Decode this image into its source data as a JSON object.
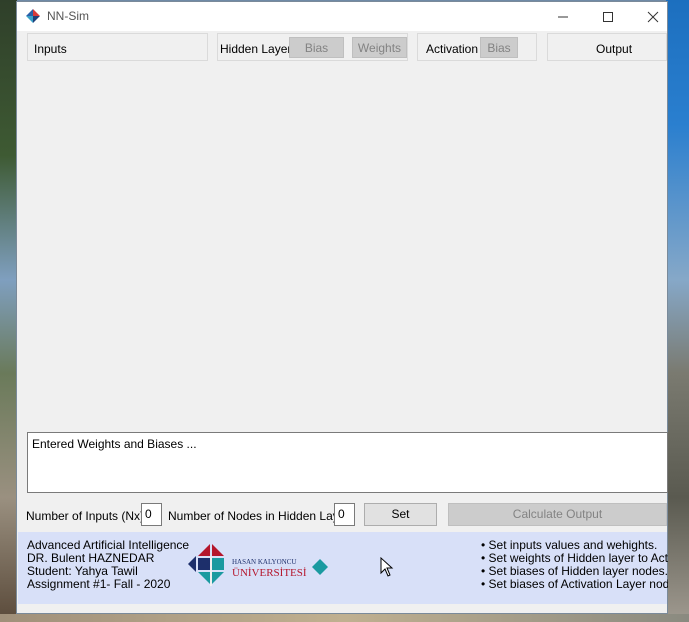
{
  "window": {
    "title": "NN-Sim",
    "min_icon": "minimize-icon",
    "max_icon": "maximize-icon",
    "close_icon": "close-icon"
  },
  "panels": {
    "inputs_label": "Inputs",
    "hidden_label": "Hidden Layer",
    "hidden_bias_button": "Bias",
    "hidden_weights_button": "Weights",
    "activation_label": "Activation",
    "activation_bias_button": "Bias",
    "output_label": "Output"
  },
  "log": {
    "text": "Entered Weights and Biases ..."
  },
  "controls": {
    "num_inputs_label": "Number of Inputs (Nx)",
    "num_inputs_value": "0",
    "num_nodes_label": "Number of Nodes in Hidden Layer",
    "num_nodes_value": "0",
    "set_button": "Set",
    "calculate_button": "Calculate Output"
  },
  "footer": {
    "lines": [
      "Advanced Artificial Intelligence",
      "DR. Bulent HAZNEDAR",
      "Student: Yahya Tawil",
      "Assignment #1- Fall - 2020"
    ],
    "logo_top": "HASAN KALYONCU",
    "logo_bottom": "ÜNİVERSİTESİ",
    "bullets": [
      "• Set inputs values and wehights.",
      "• Set weights of Hidden layer to Activat",
      "• Set biases of Hidden layer nodes.",
      "• Set biases of Activation Layer nodes."
    ]
  },
  "colors": {
    "footer_bg": "#d8e0f8",
    "logo_red": "#b5162c",
    "logo_teal": "#1a9aa0",
    "logo_navy": "#1d2f6b"
  }
}
